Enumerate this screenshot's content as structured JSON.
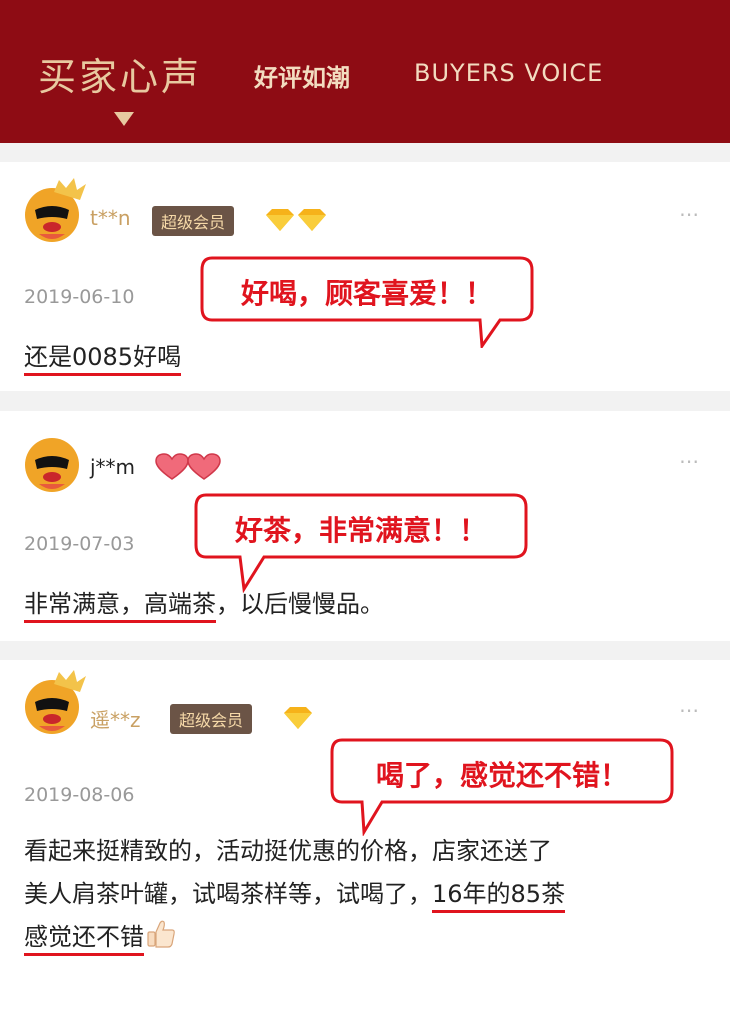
{
  "header": {
    "title": "买家心声",
    "subtitle": "好评如潮",
    "title_en": "BUYERS VOICE"
  },
  "reviews": [
    {
      "username": "t**n",
      "member_badge": "超级会员",
      "badge_icons": "diamond-icon x2",
      "date": "2019-06-10",
      "comment": "还是0085好喝",
      "bubble": "好喝，顾客喜爱！！"
    },
    {
      "username": "j**m",
      "badge_icons": "heart-icon x2",
      "date": "2019-07-03",
      "comment_underlined": "非常满意，高端茶",
      "comment_rest": "，以后慢慢品。",
      "bubble": "好茶，非常满意！！"
    },
    {
      "username": "遥**z",
      "member_badge": "超级会员",
      "badge_icons": "diamond-icon x1",
      "date": "2019-08-06",
      "comment_line1": "看起来挺精致的，活动挺优惠的价格，店家还送了",
      "comment_line2_plain": "美人肩茶叶罐，试喝茶样等，试喝了，",
      "comment_line2_underlined": "16年的85茶",
      "comment_line3_underlined": "感觉还不错",
      "bubble": "喝了，感觉还不错！"
    }
  ],
  "more_icon": "⋯",
  "colors": {
    "header_bg": "#8e0c14",
    "accent_red": "#e0141e",
    "gold": "#c9a063"
  }
}
